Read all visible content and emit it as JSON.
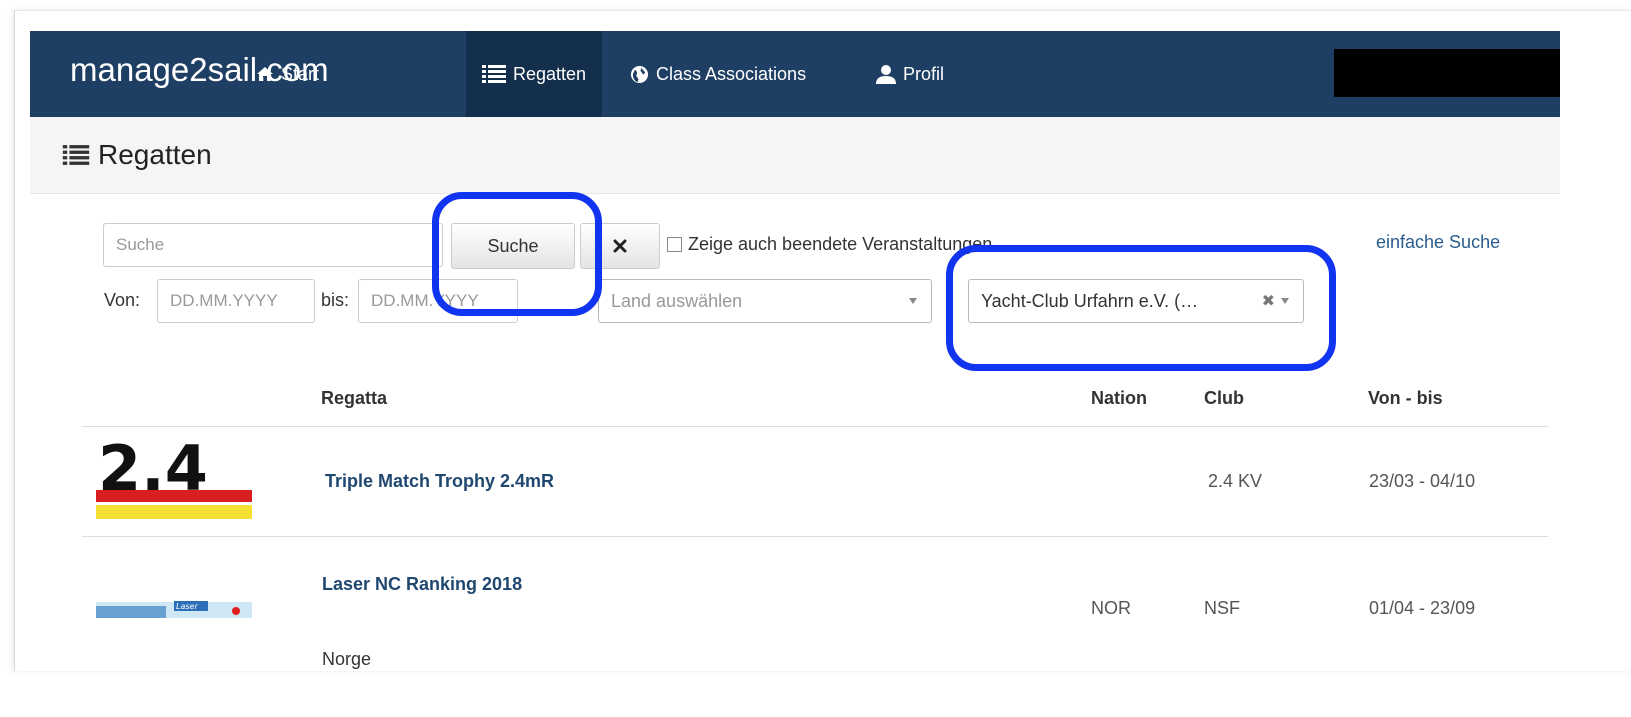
{
  "navbar": {
    "brand": "manage2sail.com",
    "items": [
      {
        "label": "Start",
        "icon": "home-icon"
      },
      {
        "label": "Regatten",
        "icon": "list-icon",
        "active": true
      },
      {
        "label": "Class Associations",
        "icon": "globe-icon"
      },
      {
        "label": "Profil",
        "icon": "user-icon"
      }
    ],
    "colors": {
      "background": "#1e3f63",
      "active": "#142f4c"
    }
  },
  "page": {
    "title": "Regatten",
    "title_icon": "list-icon"
  },
  "search": {
    "placeholder": "Suche",
    "value": "",
    "button_label": "Suche",
    "clear_icon": "close-icon",
    "checkbox_label": "Zeige auch beendete Veranstaltungen",
    "checkbox_checked": false,
    "simple_search_link": "einfache Suche",
    "from_label": "Von:",
    "from_placeholder": "DD.MM.YYYY",
    "to_label": "bis:",
    "to_placeholder": "DD.MM.YYYY",
    "country_placeholder": "Land auswählen",
    "club_selected": "Yacht-Club Urfahrn e.V. (…"
  },
  "highlight_color": "#1034f0",
  "table": {
    "headers": {
      "regatta": "Regatta",
      "nation": "Nation",
      "club": "Club",
      "dates": "Von - bis"
    },
    "rows": [
      {
        "logo": "2.4",
        "name": "Triple Match Trophy 2.4mR",
        "subtitle": "",
        "nation": "",
        "club": "2.4 KV",
        "dates": "23/03 - 04/10"
      },
      {
        "logo": "Laser",
        "name": "Laser NC Ranking 2018",
        "subtitle": "Norge",
        "nation": "NOR",
        "club": "NSF",
        "dates": "01/04 - 23/09"
      }
    ]
  }
}
